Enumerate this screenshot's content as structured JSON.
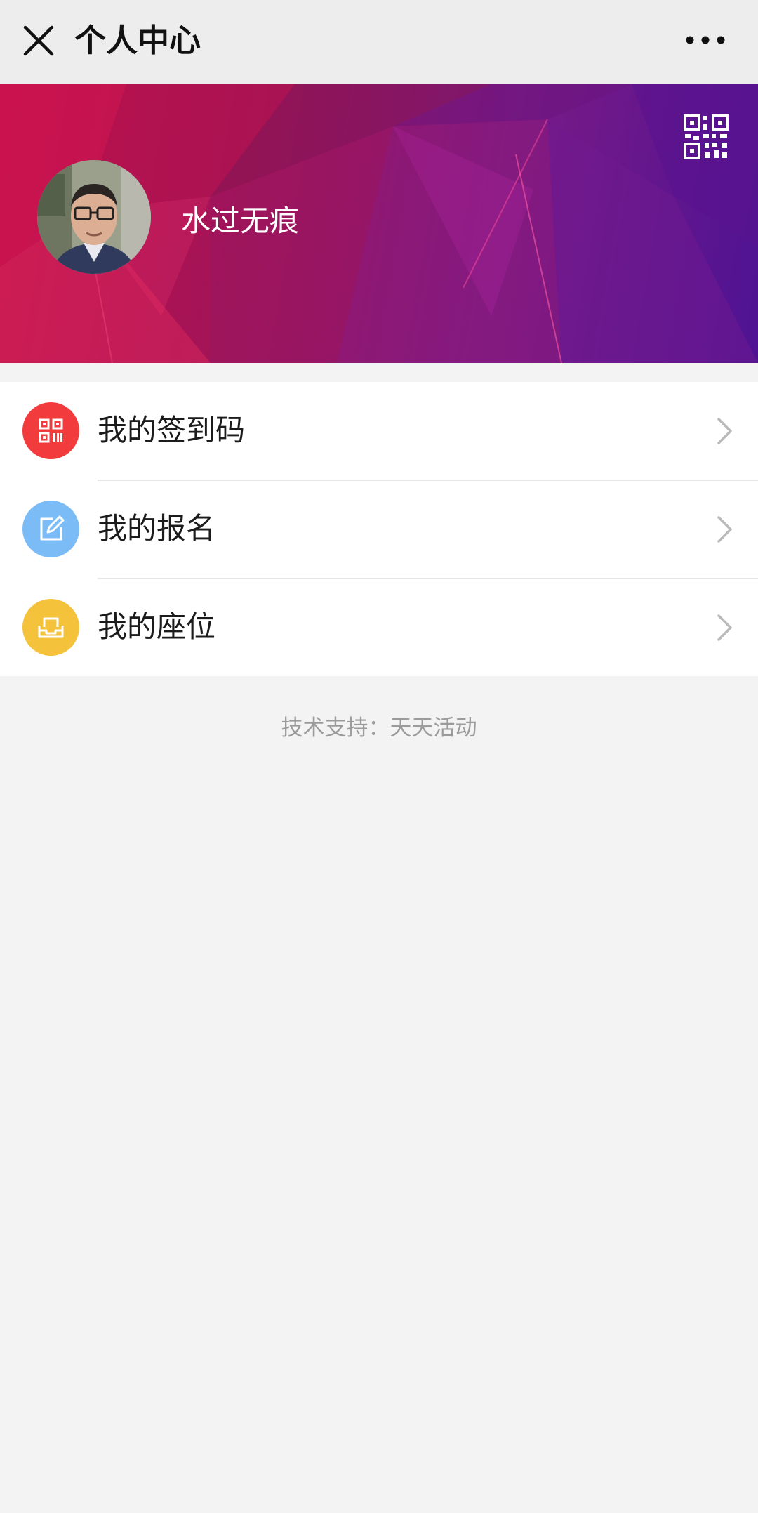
{
  "header": {
    "title": "个人中心",
    "close_icon": "close-icon",
    "more_icon": "more-dots-icon"
  },
  "profile": {
    "username": "水过无痕",
    "qr_icon": "qr-code-icon",
    "avatar": "user-avatar-photo"
  },
  "menu": {
    "items": [
      {
        "label": "我的签到码",
        "icon": "qr-code-icon",
        "color": "#f23b3c"
      },
      {
        "label": "我的报名",
        "icon": "edit-icon",
        "color": "#7cbcf6"
      },
      {
        "label": "我的座位",
        "icon": "seat-icon",
        "color": "#f4c23b"
      }
    ]
  },
  "footer": {
    "text": "技术支持：天天活动"
  },
  "colors": {
    "nav_background": "#ededed",
    "page_background": "#f3f3f3",
    "banner_start": "#c2104b",
    "banner_end": "#4e1393"
  }
}
